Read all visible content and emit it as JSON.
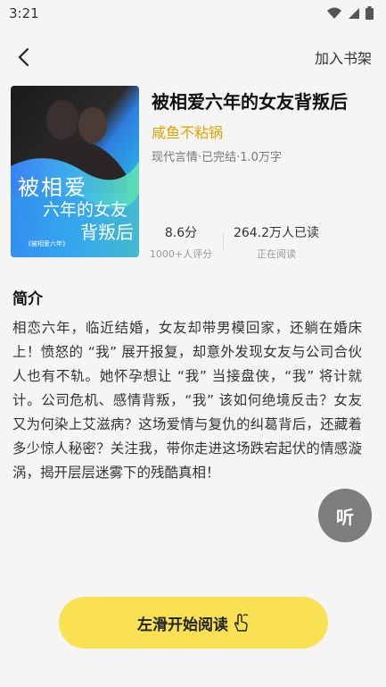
{
  "status_bar": {
    "time": "3:21"
  },
  "top_bar": {
    "add_to_shelf": "加入书架"
  },
  "book": {
    "title": "被相爱六年的女友背叛后",
    "author": "咸鱼不粘锅",
    "meta": "现代言情·已完结·1.0万字",
    "cover": {
      "title_line1": "被相爱",
      "title_line2": "六年的女友",
      "title_line3": "背叛后",
      "small_text": "《被相爱六年》"
    }
  },
  "stats": {
    "rating_value": "8.6分",
    "rating_label": "1000+人评分",
    "readers_value": "264.2万人已读",
    "readers_label": "正在阅读"
  },
  "intro": {
    "heading": "简介",
    "text": "相恋六年，临近结婚，女友却带男模回家，还躺在婚床上！愤怒的 “我” 展开报复，却意外发现女友与公司合伙人也有不轨。她怀孕想让 “我” 当接盘侠，“我” 将计就计。公司危机、感情背叛，“我” 该如何绝境反击？女友又为何染上艾滋病？这场爱情与复仇的纠葛背后，还藏着多少惊人秘密？关注我，带你走进这场跌宕起伏的情感漩涡，揭开层层迷雾下的残酷真相！"
  },
  "actions": {
    "listen": "听",
    "start_reading": "左滑开始阅读"
  },
  "colors": {
    "accent_yellow": "#fae154",
    "author_gold": "#d9a400",
    "listen_gray": "#7d7d7d"
  }
}
